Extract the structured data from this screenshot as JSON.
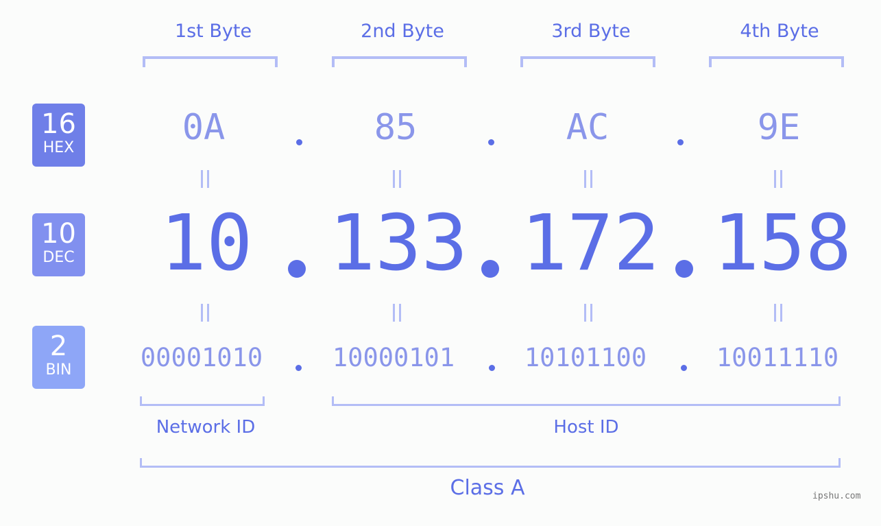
{
  "ip": "10.133.172.158",
  "rows": {
    "hex": {
      "base": "16",
      "label": "HEX",
      "color": "#6f7fe8"
    },
    "dec": {
      "base": "10",
      "label": "DEC",
      "color": "#8190ef"
    },
    "bin": {
      "base": "2",
      "label": "BIN",
      "color": "#8ea6f7"
    }
  },
  "bytes": [
    {
      "header": "1st Byte",
      "hex": "0A",
      "dec": "10",
      "bin": "00001010"
    },
    {
      "header": "2nd Byte",
      "hex": "85",
      "dec": "133",
      "bin": "10000101"
    },
    {
      "header": "3rd Byte",
      "hex": "AC",
      "dec": "172",
      "bin": "10101100"
    },
    {
      "header": "4th Byte",
      "hex": "9E",
      "dec": "158",
      "bin": "10011110"
    }
  ],
  "segments": {
    "network_id": "Network ID",
    "host_id": "Host ID",
    "class": "Class A"
  },
  "colors": {
    "primary": "#5b6ee6",
    "light": "#8a96ea",
    "bracket": "#b3bdf6"
  },
  "watermark": "ipshu.com"
}
